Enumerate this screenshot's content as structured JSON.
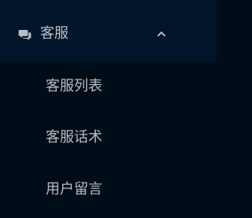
{
  "menu": {
    "title": "客服",
    "icon": "chat-icon",
    "expanded": true,
    "items": [
      {
        "label": "客服列表"
      },
      {
        "label": "客服话术"
      },
      {
        "label": "用户留言"
      }
    ]
  },
  "colors": {
    "background": "#000c17",
    "header_background": "#001529",
    "text": "#b7bec6"
  }
}
